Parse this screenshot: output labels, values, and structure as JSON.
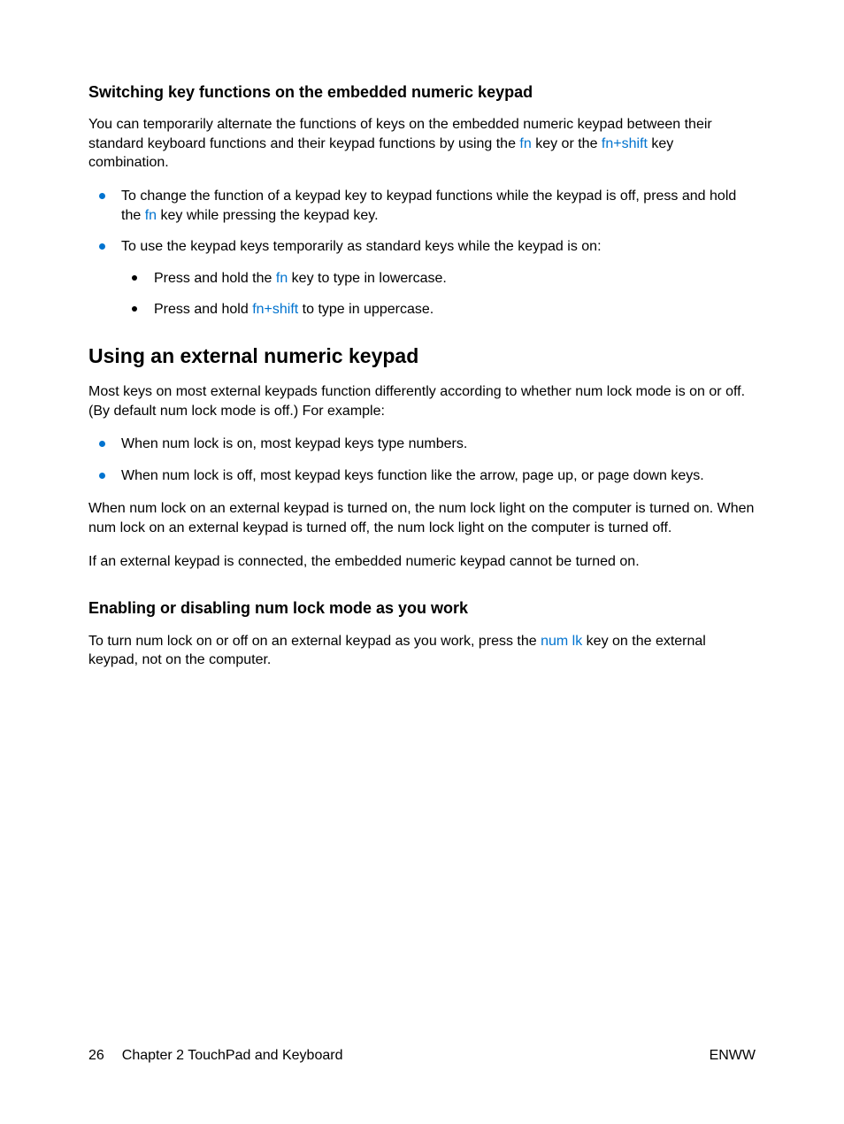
{
  "section1": {
    "heading": "Switching key functions on the embedded numeric keypad",
    "intro_pre": "You can temporarily alternate the functions of keys on the embedded numeric keypad between their standard keyboard functions and their keypad functions by using the ",
    "fn": "fn",
    "intro_mid": " key or the ",
    "fn_shift": "fn+shift",
    "intro_post": " key combination.",
    "bullet1_pre": "To change the function of a keypad key to keypad functions while the keypad is off, press and hold the ",
    "bullet1_post": " key while pressing the keypad key.",
    "bullet2": "To use the keypad keys temporarily as standard keys while the keypad is on:",
    "sub1_pre": "Press and hold the ",
    "sub1_post": " key to type in lowercase.",
    "sub2_pre": "Press and hold ",
    "sub2_post": " to type in uppercase."
  },
  "section2": {
    "heading": "Using an external numeric keypad",
    "intro": "Most keys on most external keypads function differently according to whether num lock mode is on or off. (By default num lock mode is off.) For example:",
    "bullet1": "When num lock is on, most keypad keys type numbers.",
    "bullet2": "When num lock is off, most keypad keys function like the arrow, page up, or page down keys.",
    "para1": "When num lock on an external keypad is turned on, the num lock light on the computer is turned on. When num lock on an external keypad is turned off, the num lock light on the computer is turned off.",
    "para2": "If an external keypad is connected, the embedded numeric keypad cannot be turned on."
  },
  "section3": {
    "heading": "Enabling or disabling num lock mode as you work",
    "intro_pre": "To turn num lock on or off on an external keypad as you work, press the ",
    "numlk": "num lk",
    "intro_post": " key on the external keypad, not on the computer."
  },
  "footer": {
    "page": "26",
    "chapter": "Chapter 2   TouchPad and Keyboard",
    "right": "ENWW"
  }
}
